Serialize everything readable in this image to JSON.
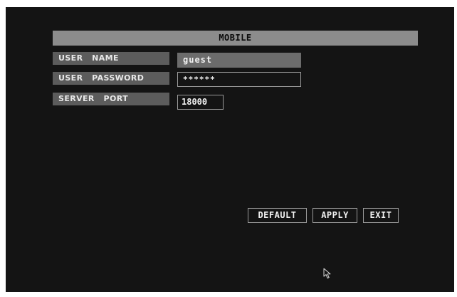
{
  "window": {
    "title": "MOBILE"
  },
  "form": {
    "username": {
      "label": "USER   NAME",
      "value": "guest"
    },
    "password": {
      "label": "USER   PASSWORD",
      "value": "******"
    },
    "server_port": {
      "label": "SERVER   PORT",
      "value": "18000"
    }
  },
  "buttons": {
    "default_label": "DEFAULT",
    "apply_label": "APPLY",
    "exit_label": "EXIT"
  },
  "colors": {
    "background": "#141414",
    "title_bar": "#8c8c8c",
    "label_bg": "#5c5c5c",
    "active_field_bg": "#6c6c6c",
    "text": "#f2f2f2"
  },
  "icons": {
    "pointer": "mouse-pointer-icon"
  }
}
